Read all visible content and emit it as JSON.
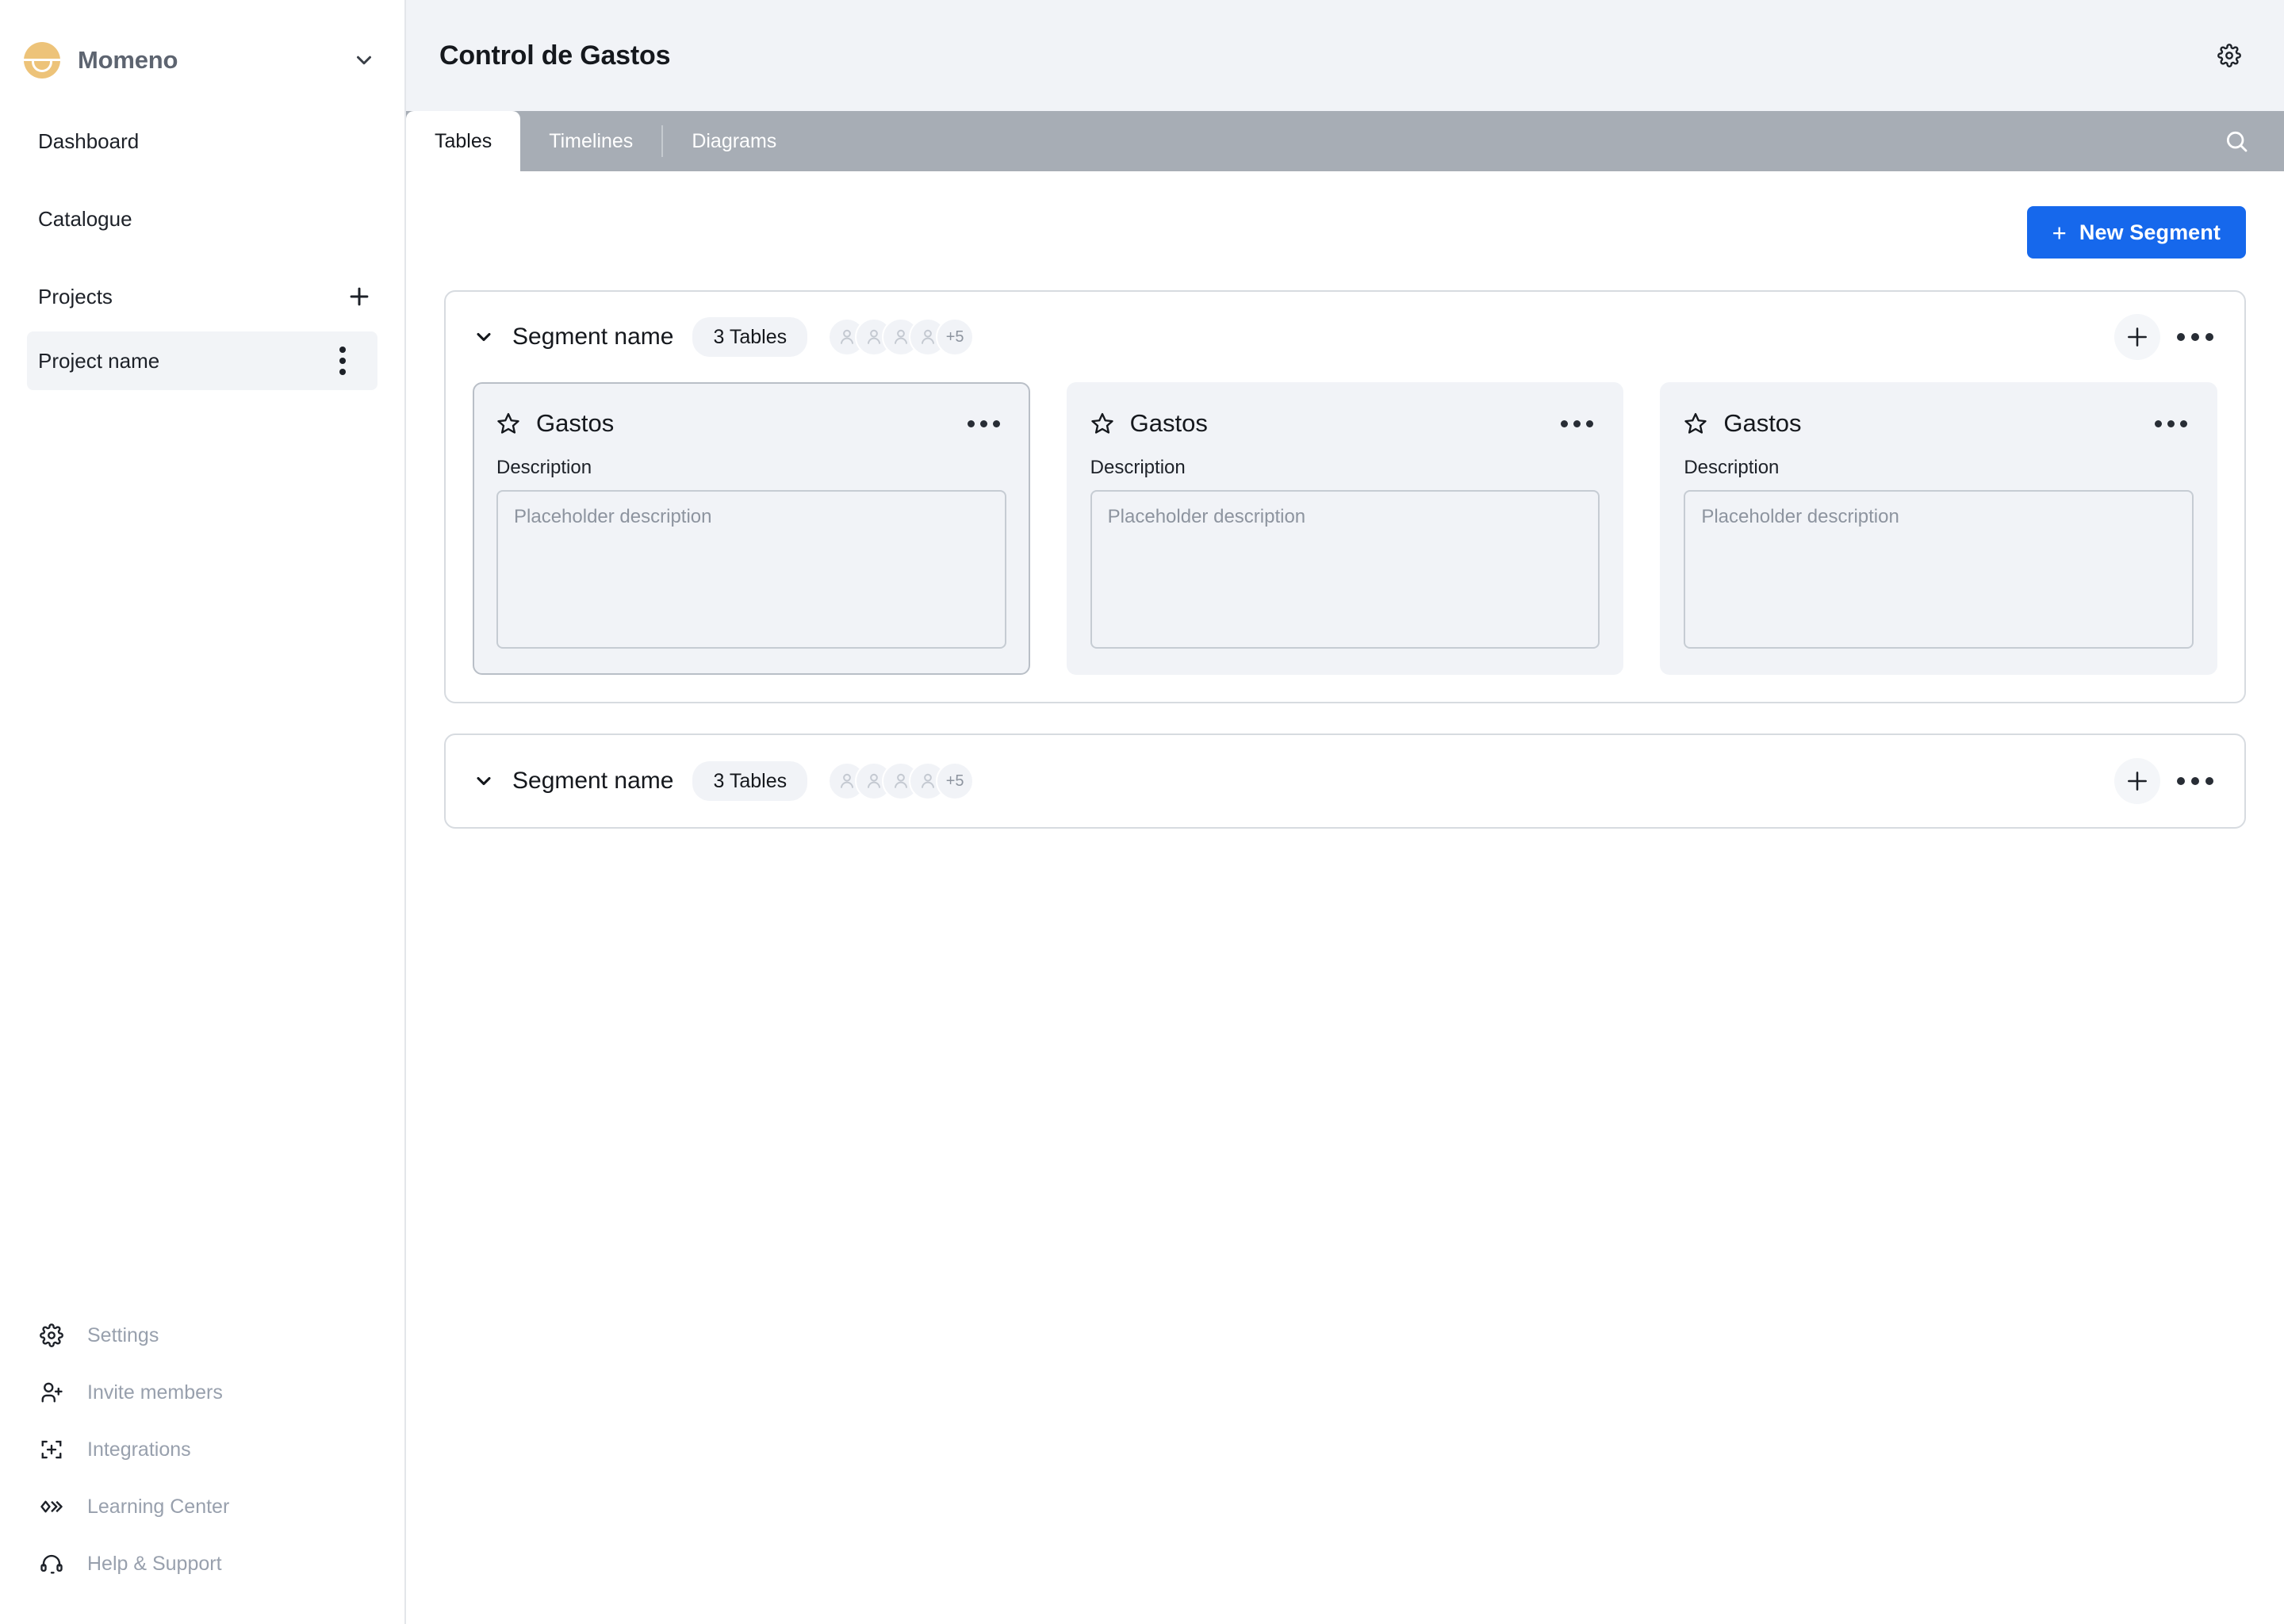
{
  "sidebar": {
    "workspace": {
      "name": "Momeno",
      "logo_icon": "smiley-circle-logo",
      "chevron_icon": "chevron-down-icon"
    },
    "nav": [
      {
        "label": "Dashboard"
      },
      {
        "label": "Catalogue"
      }
    ],
    "projects": {
      "label": "Projects",
      "add_icon": "plus-icon",
      "items": [
        {
          "label": "Project name",
          "menu_icon": "kebab-menu-icon"
        }
      ]
    },
    "bottom_items": [
      {
        "label": "Settings",
        "icon": "gear-icon"
      },
      {
        "label": "Invite members",
        "icon": "person-add-icon"
      },
      {
        "label": "Integrations",
        "icon": "puzzle-plus-icon"
      },
      {
        "label": "Learning Center",
        "icon": "chevrons-play-icon"
      },
      {
        "label": "Help & Support",
        "icon": "headset-icon"
      }
    ]
  },
  "header": {
    "title": "Control de Gastos",
    "settings_icon": "gear-icon"
  },
  "tabs": {
    "items": [
      {
        "label": "Tables",
        "active": true
      },
      {
        "label": "Timelines",
        "active": false
      },
      {
        "label": "Diagrams",
        "active": false
      }
    ],
    "search_icon": "search-icon"
  },
  "toolbar": {
    "new_segment_label": "New Segment",
    "new_segment_plus": "+"
  },
  "segments": [
    {
      "name": "Segment name",
      "tables_badge": "3 Tables",
      "chevron_icon": "chevron-down-icon",
      "add_icon": "plus-icon",
      "menu_icon": "ellipsis-icon",
      "avatars": {
        "count": 4,
        "overflow_label": "+5",
        "icon": "user-avatar-icon"
      },
      "expanded": true,
      "cards": [
        {
          "title": "Gastos",
          "star_icon": "star-outline-icon",
          "menu_icon": "ellipsis-icon",
          "description_label": "Description",
          "description_value": "",
          "description_placeholder": "Placeholder description",
          "selected": true
        },
        {
          "title": "Gastos",
          "star_icon": "star-outline-icon",
          "menu_icon": "ellipsis-icon",
          "description_label": "Description",
          "description_value": "",
          "description_placeholder": "Placeholder description",
          "selected": false
        },
        {
          "title": "Gastos",
          "star_icon": "star-outline-icon",
          "menu_icon": "ellipsis-icon",
          "description_label": "Description",
          "description_value": "",
          "description_placeholder": "Placeholder description",
          "selected": false
        }
      ]
    },
    {
      "name": "Segment name",
      "tables_badge": "3 Tables",
      "chevron_icon": "chevron-down-icon",
      "add_icon": "plus-icon",
      "menu_icon": "ellipsis-icon",
      "avatars": {
        "count": 4,
        "overflow_label": "+5",
        "icon": "user-avatar-icon"
      },
      "expanded": false,
      "cards": []
    }
  ],
  "colors": {
    "accent": "#1668ec",
    "tabbar": "#a7adb5",
    "topbar": "#f1f3f7",
    "card_bg": "#f1f3f7",
    "logo": "#edc379"
  }
}
